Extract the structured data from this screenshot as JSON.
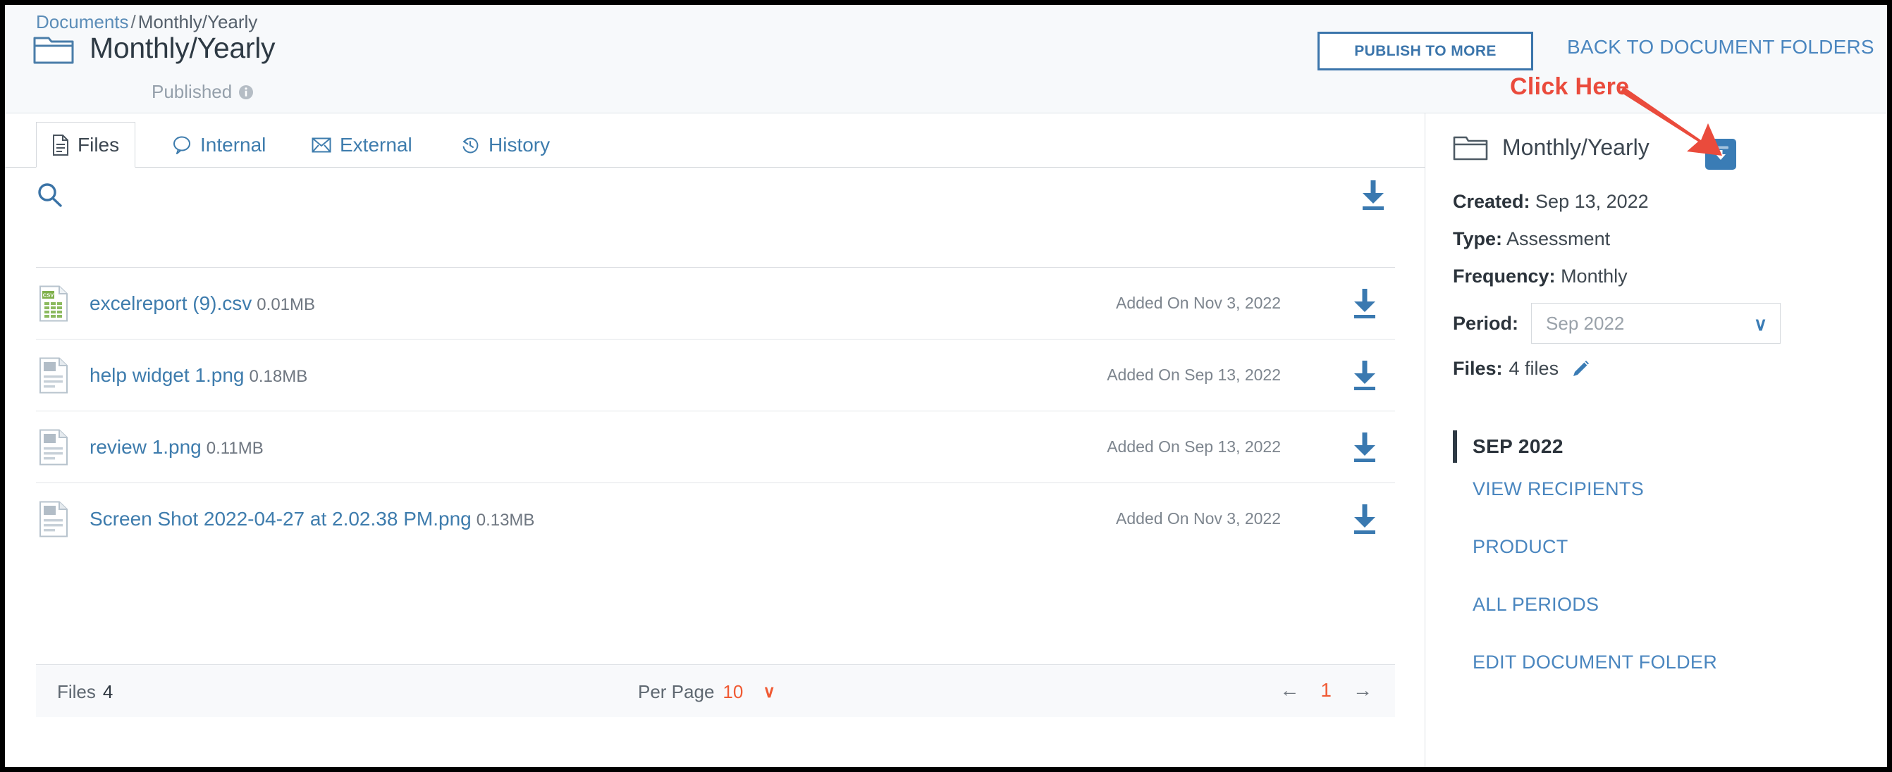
{
  "header": {
    "breadcrumb": {
      "root": "Documents",
      "separator": "/",
      "current": "Monthly/Yearly"
    },
    "folder_icon": "folder-icon",
    "title": "Monthly/Yearly",
    "status": "Published",
    "info_icon": "info-icon",
    "publish_button": "PUBLISH TO MORE",
    "back_link": "BACK TO DOCUMENT FOLDERS",
    "accent_blue": "#3b75ab"
  },
  "annotation": {
    "label": "Click Here",
    "color": "#ea4b3c",
    "arrow_icon": "arrow-pointer-icon"
  },
  "tabs": [
    {
      "label": "Files",
      "icon": "document-icon",
      "active": true
    },
    {
      "label": "Internal",
      "icon": "comment-bubble-icon",
      "active": false
    },
    {
      "label": "External",
      "icon": "envelope-icon",
      "active": false
    },
    {
      "label": "History",
      "icon": "history-clock-icon",
      "active": false
    }
  ],
  "toolbar": {
    "search_icon": "search-icon",
    "download_all_icon": "download-icon"
  },
  "files": [
    {
      "name": "excelreport (9).csv",
      "size": "0.01MB",
      "added": "Added On Nov 3, 2022",
      "icon": "csv-file-icon"
    },
    {
      "name": "help widget 1.png",
      "size": "0.18MB",
      "added": "Added On Sep 13, 2022",
      "icon": "image-file-icon"
    },
    {
      "name": "review 1.png",
      "size": "0.11MB",
      "added": "Added On Sep 13, 2022",
      "icon": "image-file-icon"
    },
    {
      "name": "Screen Shot 2022-04-27 at 2.02.38 PM.png",
      "size": "0.13MB",
      "added": "Added On Nov 3, 2022",
      "icon": "image-file-icon"
    }
  ],
  "pager": {
    "files_label": "Files",
    "files_count": "4",
    "per_page_label": "Per Page",
    "per_page_value": "10",
    "per_page_chevron": "∨",
    "prev_arrow": "←",
    "page_number": "1",
    "next_arrow": "→",
    "accent_orange": "#f05a33"
  },
  "sidebar": {
    "folder_icon": "folder-icon",
    "title": "Monthly/Yearly",
    "download_folder_icon": "folder-download-icon",
    "created_label": "Created:",
    "created_value": "Sep 13, 2022",
    "type_label": "Type:",
    "type_value": "Assessment",
    "frequency_label": "Frequency:",
    "frequency_value": "Monthly",
    "period_label": "Period:",
    "period_value": "Sep 2022",
    "period_chevron": "∨",
    "files_label": "Files:",
    "files_value": "4 files",
    "edit_files_icon": "pencil-icon",
    "period_header": "SEP 2022",
    "links": [
      {
        "label": "VIEW RECIPIENTS"
      },
      {
        "label": "PRODUCT"
      },
      {
        "label": "ALL PERIODS"
      },
      {
        "label": "EDIT DOCUMENT FOLDER"
      }
    ]
  }
}
